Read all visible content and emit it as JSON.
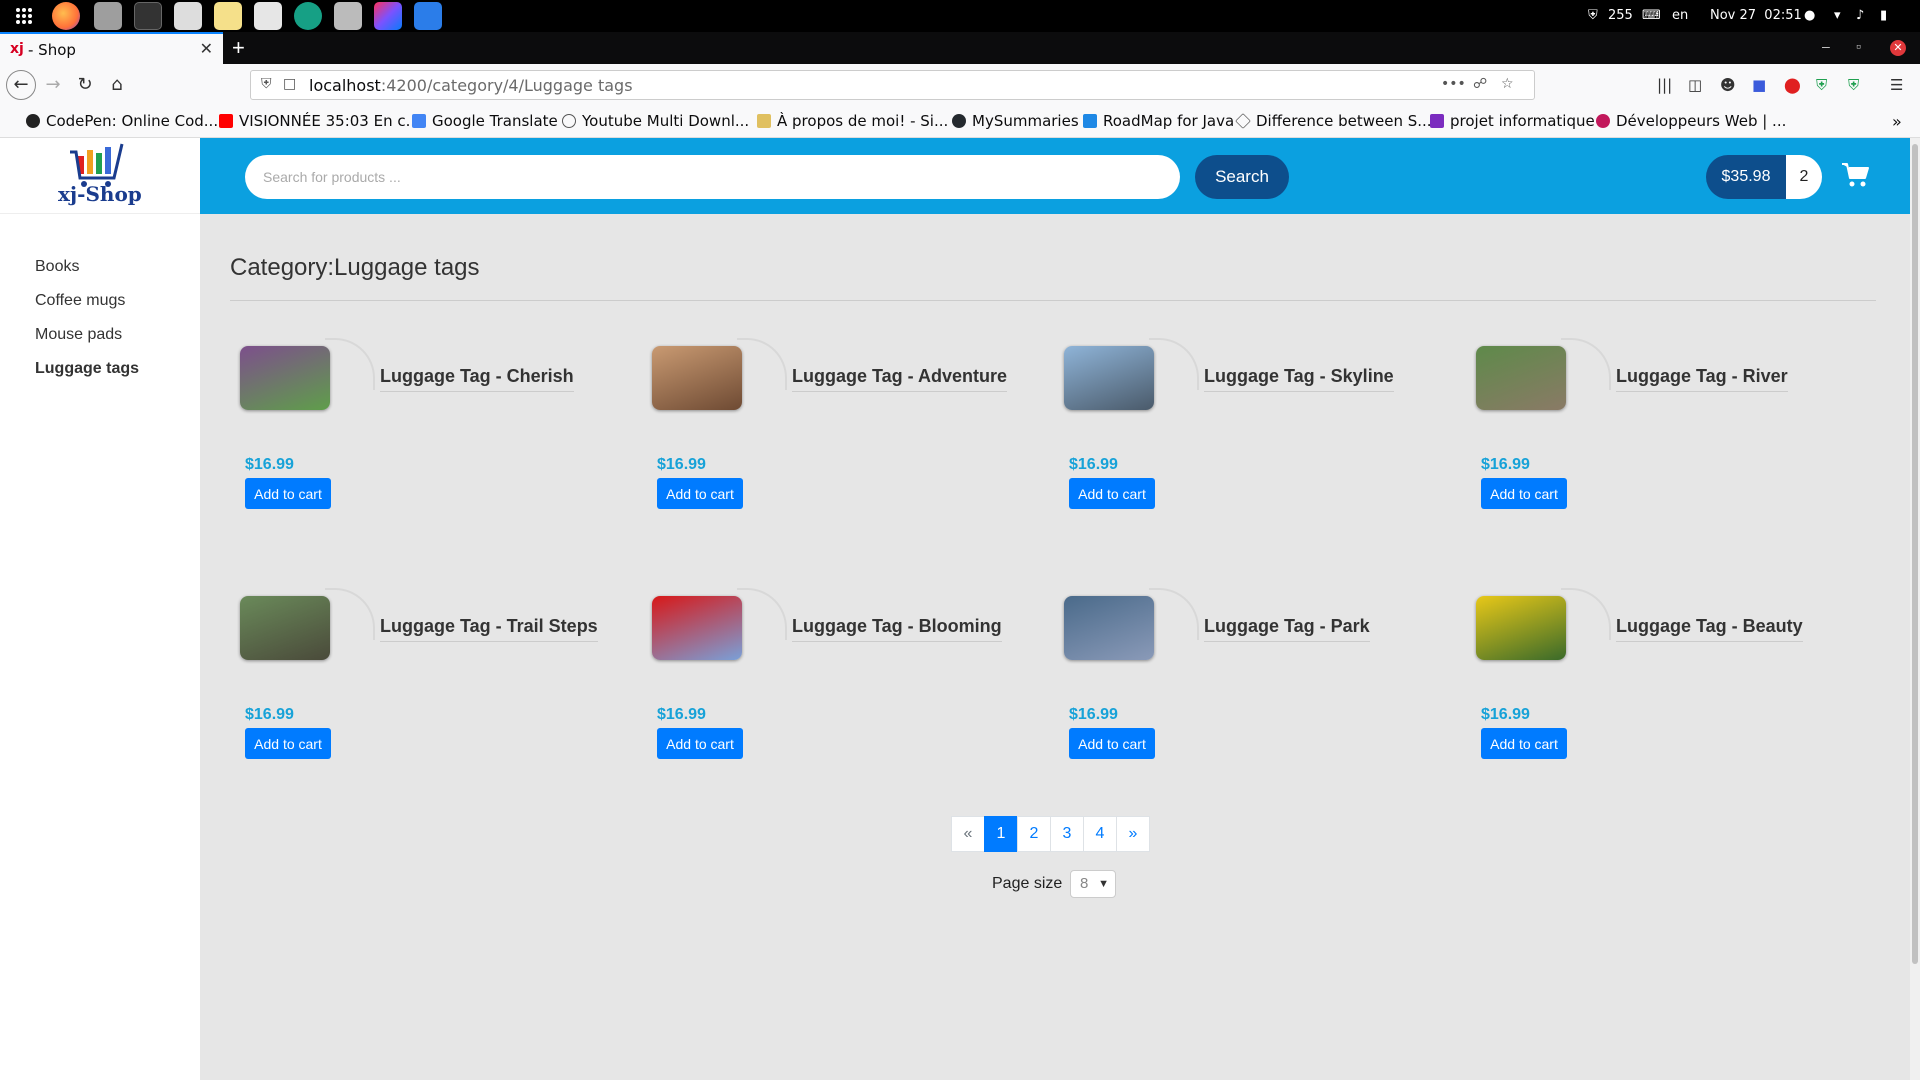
{
  "os": {
    "apps": [
      "apps-grid-icon",
      "firefox-icon",
      "files-icon",
      "terminal-icon",
      "finder-icon",
      "notes-icon",
      "clipboard-icon",
      "chrome-icon",
      "downloads-icon",
      "intellij-icon",
      "docs-icon"
    ],
    "shield_count": "255",
    "lang": "en",
    "datetime": "Nov 27  02:51"
  },
  "browser": {
    "tab_title": "- Shop",
    "tab_favicon": "xj",
    "url_host": "localhost",
    "url_path": ":4200/category/4/Luggage tags",
    "url_more": "•••",
    "new_tab": "+"
  },
  "bookmarks": [
    {
      "label": "CodePen: Online Cod...",
      "color": "#222222"
    },
    {
      "label": "VISIONNÉE 35:03 En c...",
      "color": "#ff0000"
    },
    {
      "label": "Google Translate",
      "color": "#4285f4"
    },
    {
      "label": "Youtube Multi Downl...",
      "color": "#555555"
    },
    {
      "label": "À propos de moi! - Si...",
      "color": "#e0c060"
    },
    {
      "label": "MySummaries",
      "color": "#24292e"
    },
    {
      "label": "RoadMap for Java",
      "color": "#1e88e5"
    },
    {
      "label": "Difference between S...",
      "color": "#666666"
    },
    {
      "label": "projet informatique",
      "color": "#7b2cbf"
    },
    {
      "label": "Développeurs Web | ...",
      "color": "#c2185b"
    }
  ],
  "shop": {
    "logo_text": "xj-Shop",
    "search_placeholder": "Search for products ...",
    "search_label": "Search",
    "cart_total": "$35.98",
    "cart_count": "2",
    "categories": [
      {
        "label": "Books",
        "active": false
      },
      {
        "label": "Coffee mugs",
        "active": false
      },
      {
        "label": "Mouse pads",
        "active": false
      },
      {
        "label": "Luggage tags",
        "active": true
      }
    ],
    "page_title": "Category:Luggage tags",
    "add_label": "Add to cart",
    "products": [
      {
        "name": "Luggage Tag - Cherish",
        "price": "$16.99",
        "thumb": [
          "#7d4f8c",
          "#5f9e4a"
        ]
      },
      {
        "name": "Luggage Tag - Adventure",
        "price": "$16.99",
        "thumb": [
          "#c99a72",
          "#6e4a33"
        ]
      },
      {
        "name": "Luggage Tag - Skyline",
        "price": "$16.99",
        "thumb": [
          "#8fb4d8",
          "#4a5a6a"
        ]
      },
      {
        "name": "Luggage Tag - River",
        "price": "$16.99",
        "thumb": [
          "#5e8a4a",
          "#8a7a66"
        ]
      },
      {
        "name": "Luggage Tag - Trail Steps",
        "price": "$16.99",
        "thumb": [
          "#6a8a5a",
          "#4a4a3a"
        ]
      },
      {
        "name": "Luggage Tag - Blooming",
        "price": "$16.99",
        "thumb": [
          "#d81818",
          "#7aa0d8"
        ]
      },
      {
        "name": "Luggage Tag - Park",
        "price": "$16.99",
        "thumb": [
          "#4a6a8a",
          "#8a9ab8"
        ]
      },
      {
        "name": "Luggage Tag - Beauty",
        "price": "$16.99",
        "thumb": [
          "#e8c818",
          "#3a6a2a"
        ]
      }
    ],
    "pagination": [
      "«",
      "1",
      "2",
      "3",
      "4",
      "»"
    ],
    "pagination_active": "1",
    "page_size_label": "Page size",
    "page_size_value": "8"
  }
}
